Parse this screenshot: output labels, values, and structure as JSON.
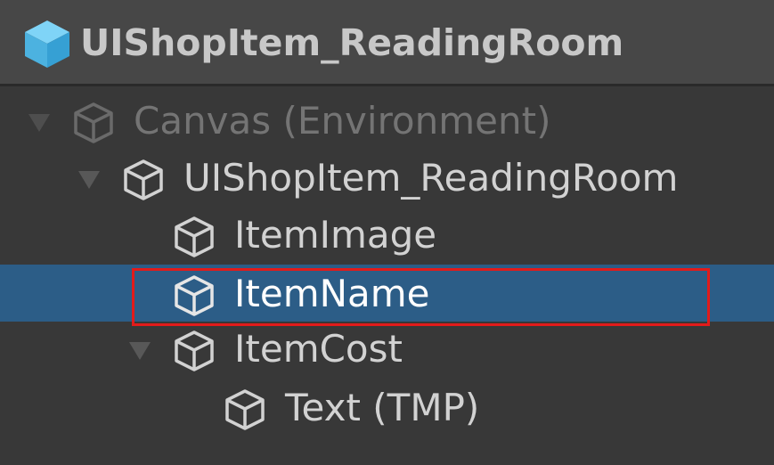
{
  "header": {
    "title": "UIShopItem_ReadingRoom",
    "icon": "prefab-cube-icon",
    "icon_color": "#5ec4f2"
  },
  "hierarchy": {
    "rows": [
      {
        "label": "Canvas (Environment)",
        "expanded": true,
        "dimmed": true,
        "icon": "gameobject-cube-icon"
      },
      {
        "label": "UIShopItem_ReadingRoom",
        "expanded": true,
        "dimmed": false,
        "icon": "gameobject-cube-icon"
      },
      {
        "label": "ItemImage",
        "expanded": false,
        "dimmed": false,
        "icon": "gameobject-cube-icon"
      },
      {
        "label": "ItemName",
        "expanded": false,
        "dimmed": false,
        "selected": true,
        "icon": "gameobject-cube-icon"
      },
      {
        "label": "ItemCost",
        "expanded": true,
        "dimmed": false,
        "icon": "gameobject-cube-icon"
      },
      {
        "label": "Text (TMP)",
        "expanded": false,
        "dimmed": false,
        "icon": "gameobject-cube-icon"
      }
    ]
  },
  "colors": {
    "background": "#383838",
    "header_background": "#474747",
    "selection": "#2c5d87",
    "highlight_border": "#e21b1b",
    "text": "#d2d2d2",
    "dimmed_text": "#747474"
  }
}
